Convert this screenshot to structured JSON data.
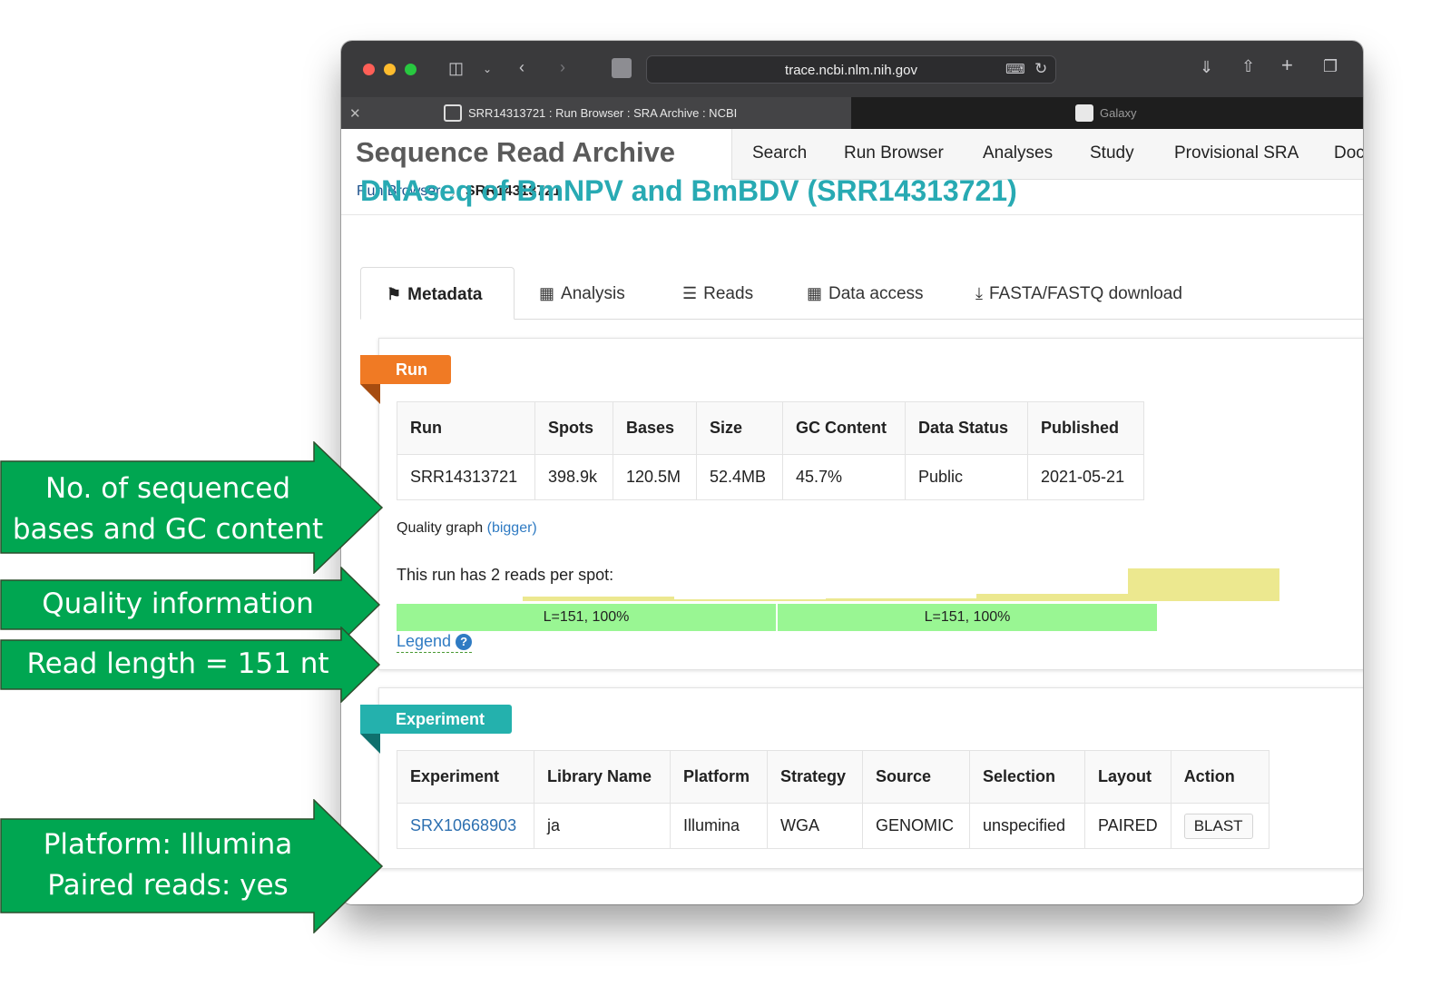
{
  "browser": {
    "url": "trace.ncbi.nlm.nih.gov",
    "tabs": [
      {
        "title": "SRR14313721 : Run Browser : SRA Archive : NCBI",
        "active": true
      },
      {
        "title": "Galaxy",
        "active": false
      }
    ]
  },
  "site": {
    "title": "Sequence Read Archive",
    "nav": [
      "Search",
      "Run Browser",
      "Analyses",
      "Study",
      "Provisional SRA",
      "Doc"
    ]
  },
  "breadcrumb": {
    "parent": "Run Browser",
    "current": "SRR14313721"
  },
  "page_title": "DNAseq of BmNPV and BmBDV (SRR14313721)",
  "page_tabs": [
    {
      "label": "Metadata",
      "icon": "tags-icon",
      "active": true
    },
    {
      "label": "Analysis",
      "icon": "sitemap-icon"
    },
    {
      "label": "Reads",
      "icon": "list-icon"
    },
    {
      "label": "Data access",
      "icon": "database-icon"
    },
    {
      "label": "FASTA/FASTQ download",
      "icon": "download-icon"
    }
  ],
  "run": {
    "ribbon": "Run",
    "columns": [
      "Run",
      "Spots",
      "Bases",
      "Size",
      "GC Content",
      "Data Status",
      "Published"
    ],
    "row": [
      "SRR14313721",
      "398.9k",
      "120.5M",
      "52.4MB",
      "45.7%",
      "Public",
      "2021-05-21"
    ],
    "quality_label": "Quality graph",
    "quality_link": "(bigger)",
    "quality_levels": [
      0.15,
      0.0,
      0.08,
      0.22,
      1.0
    ],
    "reads_text": "This run has 2 reads per spot:",
    "reads": [
      "L=151, 100%",
      "L=151, 100%"
    ],
    "legend": "Legend",
    "legend_icon": "?"
  },
  "experiment": {
    "ribbon": "Experiment",
    "columns": [
      "Experiment",
      "Library Name",
      "Platform",
      "Strategy",
      "Source",
      "Selection",
      "Layout",
      "Action"
    ],
    "row": [
      "SRX10668903",
      "ja",
      "Illumina",
      "WGA",
      "GENOMIC",
      "unspecified",
      "PAIRED",
      "BLAST"
    ]
  },
  "callouts": [
    {
      "lines": [
        "No. of sequenced",
        "bases and GC content"
      ]
    },
    {
      "lines": [
        "Quality information"
      ]
    },
    {
      "lines": [
        "Read length = 151 nt"
      ]
    },
    {
      "lines": [
        "Platform: Illumina",
        "Paired reads: yes"
      ]
    }
  ],
  "colors": {
    "callout_fill": "#00a651",
    "heading": "#28aab3",
    "run_ribbon": "#f07a24",
    "experiment_ribbon": "#24b1ad",
    "read_bar": "#99f693",
    "quality_bar": "#ece88f"
  }
}
